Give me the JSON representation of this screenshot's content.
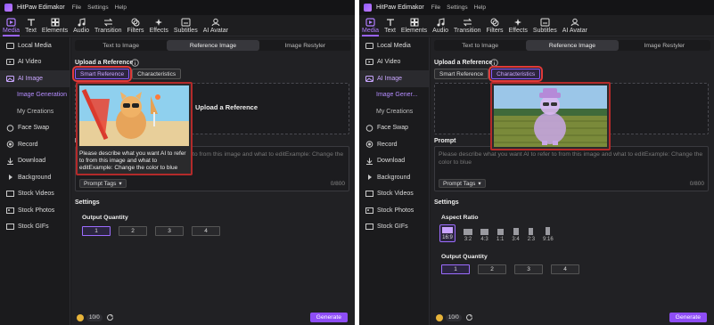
{
  "app": {
    "title": "HitPaw Edimakor",
    "menu": [
      "File",
      "Settings",
      "Help"
    ]
  },
  "toolbar": [
    {
      "label": "Media",
      "icon": "media-icon"
    },
    {
      "label": "Text",
      "icon": "text-icon"
    },
    {
      "label": "Elements",
      "icon": "elements-icon"
    },
    {
      "label": "Audio",
      "icon": "audio-icon"
    },
    {
      "label": "Transition",
      "icon": "transition-icon"
    },
    {
      "label": "Filters",
      "icon": "filters-icon"
    },
    {
      "label": "Effects",
      "icon": "effects-icon"
    },
    {
      "label": "Subtitles",
      "icon": "subtitles-icon"
    },
    {
      "label": "AI Avatar",
      "icon": "ai-avatar-icon"
    }
  ],
  "sidebar": [
    {
      "label": "Local Media",
      "icon": "folder-icon"
    },
    {
      "label": "AI Video",
      "icon": "ai-video-icon"
    },
    {
      "label": "AI Image",
      "icon": "ai-image-icon"
    },
    {
      "label": "Image Generation",
      "label_truncated": "Image Gener..."
    },
    {
      "label": "My Creations"
    },
    {
      "label": "Face Swap",
      "icon": "face-swap-icon"
    },
    {
      "label": "Record",
      "icon": "record-icon"
    },
    {
      "label": "Download",
      "icon": "download-icon"
    },
    {
      "label": "Background",
      "icon": "background-icon"
    },
    {
      "label": "Stock Videos",
      "icon": "stock-videos-icon"
    },
    {
      "label": "Stock Photos",
      "icon": "stock-photos-icon"
    },
    {
      "label": "Stock GIFs",
      "icon": "stock-gifs-icon"
    }
  ],
  "tabs": [
    "Text to Image",
    "Reference Image",
    "Image Restyler"
  ],
  "upload": {
    "title": "Upload a Reference",
    "subtabs": [
      "Smart Reference",
      "Characteristics"
    ],
    "drop_text": "Upload a Reference"
  },
  "prompt": {
    "label": "Prompt",
    "placeholder": "Please describe what you want AI to refer to from this image and what to editExample: Change the color to blue",
    "tags": "Prompt Tags",
    "count": "0/800"
  },
  "settings": {
    "label": "Settings",
    "aspect_label": "Aspect Ratio",
    "aspect": [
      "16:9",
      "3:2",
      "4:3",
      "1:1",
      "3:4",
      "2:3",
      "9:16"
    ],
    "quantity_label": "Output Quantity",
    "quantity": [
      "1",
      "2",
      "3",
      "4"
    ]
  },
  "bottom": {
    "credits": "10/0",
    "generate": "Generate"
  },
  "popup_left_text": "Please describe what you want AI to refer to from this image and what to editExample: Change the color to blue",
  "colors": {
    "accent": "#9a63ff",
    "highlight": "#e03a3a",
    "generate": "#8e4df6"
  }
}
